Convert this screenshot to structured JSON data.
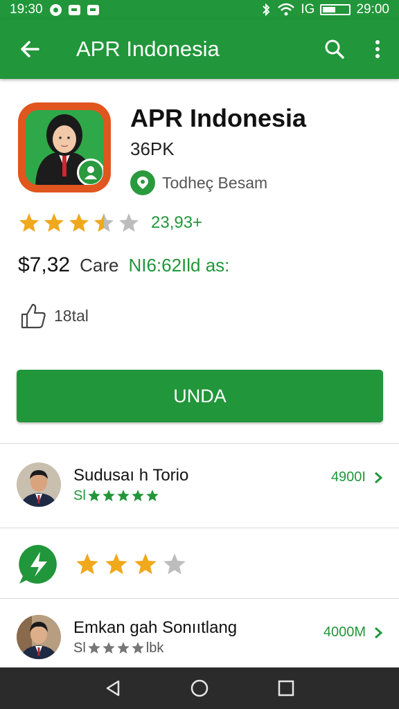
{
  "status_bar": {
    "time_left": "19:30",
    "carrier_text": "IG",
    "time_right": "29:00"
  },
  "app_bar": {
    "title": "APR Indonesia",
    "icons": [
      "arrow-back-icon",
      "search-icon",
      "more-vert-icon"
    ]
  },
  "app": {
    "name": "APR Indonesia",
    "size": "36PK",
    "developer": "Todheç Besam",
    "rating_value": 3.5,
    "rating_count": "23,93+",
    "price": "$7,32",
    "price_label": "Care",
    "price_extra": "NI6:62Ild as:",
    "likes_text": "18tal",
    "install_label": "UNDA"
  },
  "list": [
    {
      "title": "Sudusaı h Torio",
      "sub_prefix": "Sl",
      "stars": 5,
      "right_text": "4900I"
    },
    {
      "stars_filled": 3,
      "stars_total": 4
    },
    {
      "title": "Emkan gah Sonııtlang",
      "sub_prefix": "Sl",
      "sub_suffix": "lbk",
      "stars": 4,
      "right_text": "4000M"
    }
  ],
  "colors": {
    "brand_green": "#21963a",
    "star_gold": "#f0a81c",
    "star_gray": "#bdbdbd",
    "icon_orange": "#e0561e"
  }
}
